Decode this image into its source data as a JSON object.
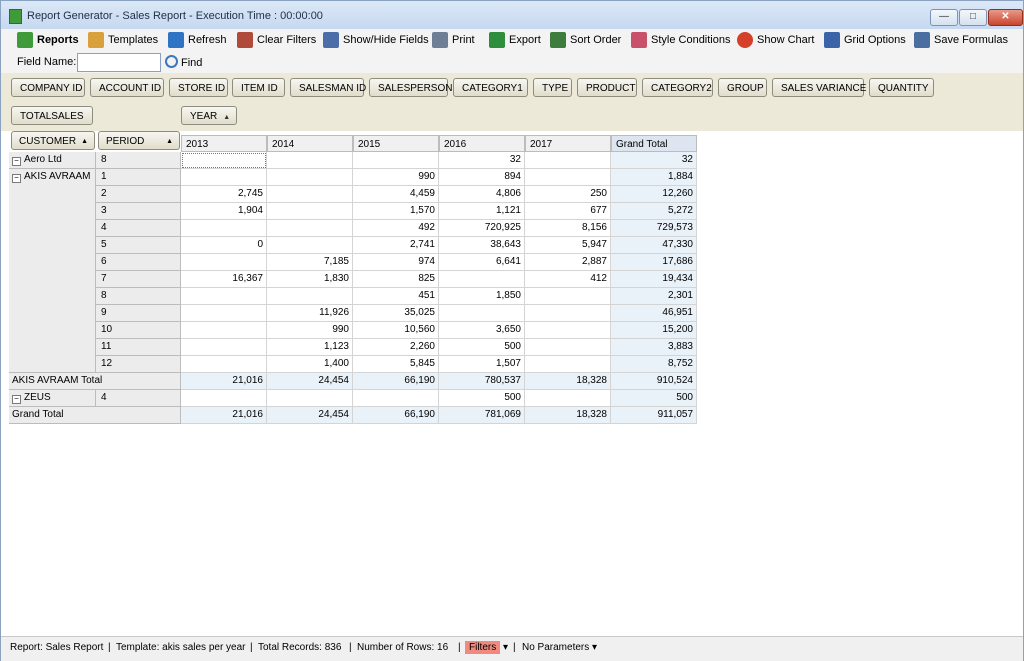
{
  "window": {
    "title": "Report Generator - Sales Report - Execution Time : 00:00:00"
  },
  "toolbar": [
    {
      "label": "Reports",
      "icon": "reports-icon",
      "bold": true
    },
    {
      "label": "Templates",
      "icon": "templates-icon"
    },
    {
      "label": "Refresh",
      "icon": "refresh-icon"
    },
    {
      "label": "Clear Filters",
      "icon": "clear-filters-icon"
    },
    {
      "label": "Show/Hide Fields",
      "icon": "show-hide-fields-icon"
    },
    {
      "label": "Print",
      "icon": "printer-icon"
    },
    {
      "label": "Export",
      "icon": "export-icon"
    },
    {
      "label": "Sort Order",
      "icon": "sort-order-icon"
    },
    {
      "label": "Style Conditions",
      "icon": "style-conditions-icon"
    },
    {
      "label": "Show Chart",
      "icon": "pie-chart-icon"
    },
    {
      "label": "Grid Options",
      "icon": "grid-options-icon"
    },
    {
      "label": "Save Formulas",
      "icon": "save-icon"
    }
  ],
  "find": {
    "field_label": "Field Name:",
    "value": "",
    "button": "Find"
  },
  "fields": [
    "COMPANY ID",
    "ACCOUNT ID",
    "STORE ID",
    "ITEM ID",
    "SALESMAN ID",
    "SALESPERSON",
    "CATEGORY1",
    "TYPE",
    "PRODUCT",
    "CATEGORY2",
    "GROUP",
    "SALES VARIANCE",
    "QUANTITY"
  ],
  "data_field": "TOTALSALES",
  "column_field": "YEAR",
  "row_fields": [
    "CUSTOMER",
    "PERIOD"
  ],
  "columns": [
    "2013",
    "2014",
    "2015",
    "2016",
    "2017",
    "Grand Total"
  ],
  "pivot": {
    "groups": [
      {
        "customer": "Aero Ltd",
        "rows": [
          {
            "period": "8",
            "values": [
              "",
              "",
              "",
              "32",
              "",
              "32"
            ]
          }
        ]
      },
      {
        "customer": "AKIS AVRAAM",
        "rows": [
          {
            "period": "1",
            "values": [
              "",
              "",
              "990",
              "894",
              "",
              "1,884"
            ]
          },
          {
            "period": "2",
            "values": [
              "2,745",
              "",
              "4,459",
              "4,806",
              "250",
              "12,260"
            ]
          },
          {
            "period": "3",
            "values": [
              "1,904",
              "",
              "1,570",
              "1,121",
              "677",
              "5,272"
            ]
          },
          {
            "period": "4",
            "values": [
              "",
              "",
              "492",
              "720,925",
              "8,156",
              "729,573"
            ]
          },
          {
            "period": "5",
            "values": [
              "0",
              "",
              "2,741",
              "38,643",
              "5,947",
              "47,330"
            ]
          },
          {
            "period": "6",
            "values": [
              "",
              "7,185",
              "974",
              "6,641",
              "2,887",
              "17,686"
            ]
          },
          {
            "period": "7",
            "values": [
              "16,367",
              "1,830",
              "825",
              "",
              "412",
              "19,434"
            ]
          },
          {
            "period": "8",
            "values": [
              "",
              "",
              "451",
              "1,850",
              "",
              "2,301"
            ]
          },
          {
            "period": "9",
            "values": [
              "",
              "11,926",
              "35,025",
              "",
              "",
              "46,951"
            ]
          },
          {
            "period": "10",
            "values": [
              "",
              "990",
              "10,560",
              "3,650",
              "",
              "15,200"
            ]
          },
          {
            "period": "11",
            "values": [
              "",
              "1,123",
              "2,260",
              "500",
              "",
              "3,883"
            ]
          },
          {
            "period": "12",
            "values": [
              "",
              "1,400",
              "5,845",
              "1,507",
              "",
              "8,752"
            ]
          }
        ],
        "total_label": "AKIS AVRAAM Total",
        "total": [
          "21,016",
          "24,454",
          "66,190",
          "780,537",
          "18,328",
          "910,524"
        ]
      },
      {
        "customer": "ZEUS",
        "rows": [
          {
            "period": "4",
            "values": [
              "",
              "",
              "",
              "500",
              "",
              "500"
            ]
          }
        ]
      }
    ],
    "grand_total_label": "Grand Total",
    "grand_total": [
      "21,016",
      "24,454",
      "66,190",
      "781,069",
      "18,328",
      "911,057"
    ]
  },
  "status": {
    "report": "Report: Sales Report",
    "template": "Template: akis sales per year",
    "records": "Total Records:  836",
    "rows": "Number of Rows:  16",
    "filters": "Filters",
    "params": "No Parameters"
  }
}
